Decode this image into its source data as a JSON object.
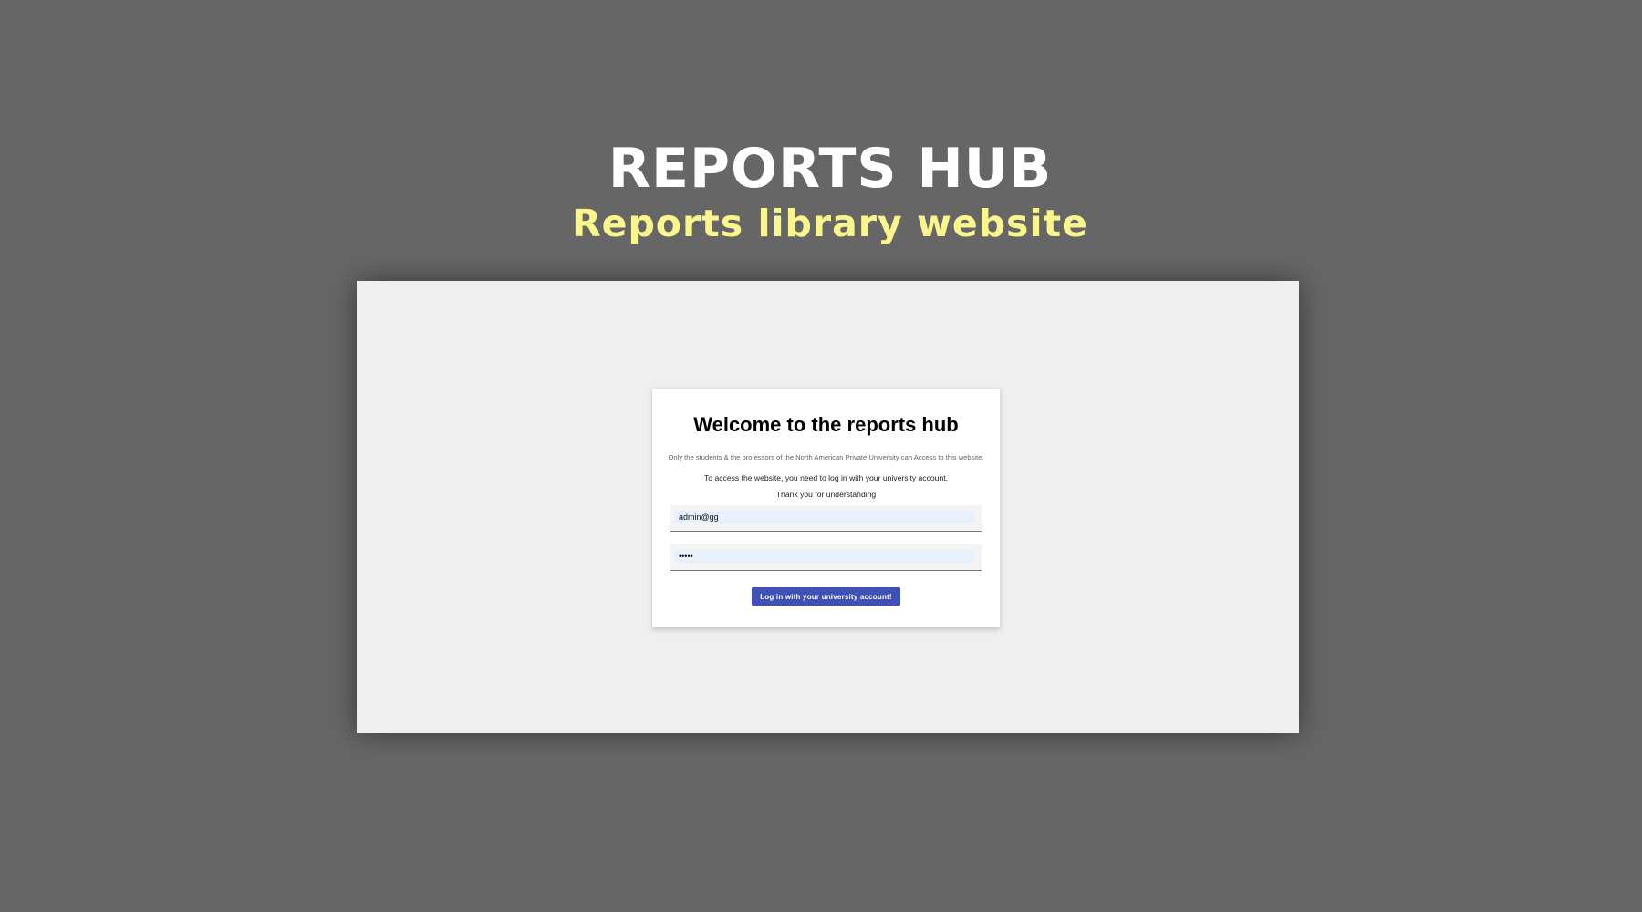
{
  "hero": {
    "title": "REPORTS HUB",
    "subtitle": "Reports library website"
  },
  "login_card": {
    "title": "Welcome to the reports hub",
    "note": "Only the students & the professors of the North American Private University can Access to this website.",
    "instructions": "To access the website, you need to log in with your university account.",
    "thanks": "Thank you for understanding",
    "email_value": "admin@gg",
    "password_value": "•••••",
    "button_label": "Log in with your university account!"
  },
  "colors": {
    "background": "#666666",
    "subtitle": "#fbf58d",
    "button": "#3f51b5"
  }
}
